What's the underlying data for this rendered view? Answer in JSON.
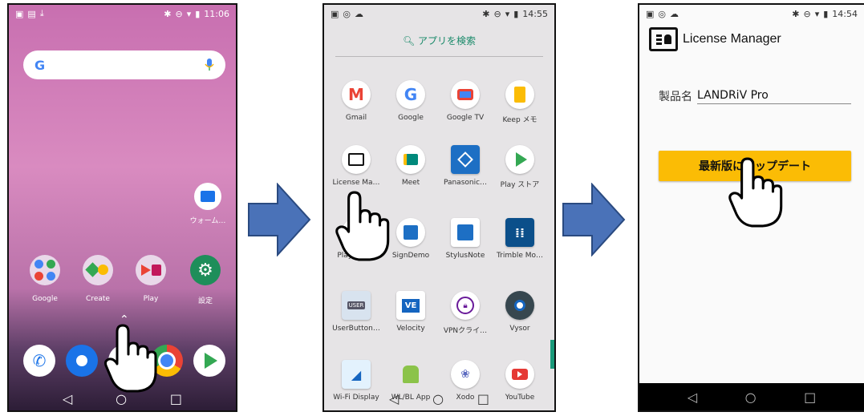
{
  "phone1": {
    "status_time": "11:06",
    "search_logo": "G",
    "widget_label": "ウォーム…",
    "folders": [
      {
        "label": "Google"
      },
      {
        "label": "Create"
      },
      {
        "label": "Play"
      },
      {
        "label": "設定"
      }
    ]
  },
  "phone2": {
    "status_time": "14:55",
    "search_label": "アプリを検索",
    "apps": [
      {
        "label": "Gmail",
        "icon": "gmail-icon"
      },
      {
        "label": "Google",
        "icon": "google-icon"
      },
      {
        "label": "Google TV",
        "icon": "google-tv-icon"
      },
      {
        "label": "Keep メモ",
        "icon": "keep-icon"
      },
      {
        "label": "License Ma…",
        "icon": "license-icon"
      },
      {
        "label": "Meet",
        "icon": "meet-icon"
      },
      {
        "label": "Panasonic…",
        "icon": "panasonic-icon"
      },
      {
        "label": "Play ストア",
        "icon": "play-store-icon"
      },
      {
        "label": "Play Music",
        "icon": "play-music-icon"
      },
      {
        "label": "SignDemo",
        "icon": "signdemo-icon"
      },
      {
        "label": "StylusNote",
        "icon": "stylusnote-icon"
      },
      {
        "label": "Trimble Mo…",
        "icon": "trimble-icon"
      },
      {
        "label": "UserButton…",
        "icon": "userbutton-icon"
      },
      {
        "label": "Velocity",
        "icon": "velocity-icon"
      },
      {
        "label": "VPNクライ…",
        "icon": "vpn-icon"
      },
      {
        "label": "Vysor",
        "icon": "vysor-icon"
      },
      {
        "label": "Wi-Fi Display",
        "icon": "wifi-display-icon"
      },
      {
        "label": "WL/BL App",
        "icon": "wlbl-icon"
      },
      {
        "label": "Xodo",
        "icon": "xodo-icon"
      },
      {
        "label": "YouTube",
        "icon": "youtube-icon"
      }
    ],
    "velocity_badge": "VE",
    "userbutton_badge": "USER"
  },
  "phone3": {
    "status_time": "14:54",
    "app_title": "License Manager",
    "product_label": "製品名",
    "product_value": "LANDRiV Pro",
    "update_button": "最新版にアップデート"
  },
  "colors": {
    "arrow_fill": "#4a72b8",
    "arrow_stroke": "#2a4a80",
    "update_button": "#fbbc05",
    "wallpaper_top": "#c978b5"
  }
}
